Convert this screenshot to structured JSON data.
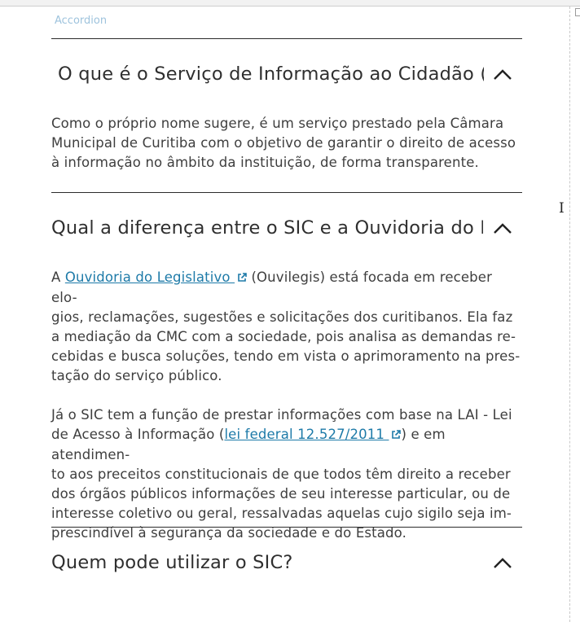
{
  "accordion": {
    "caption": "Accordion",
    "items": [
      {
        "title": "O que é o Serviço de Informação ao Cidadão (SIC)?",
        "expanded": true,
        "body": [
          "Como o próprio nome sugere, é um serviço prestado pela Câmara",
          "Municipal de Curitiba com o objetivo de garantir o direito de acesso",
          "à informação no âmbito da instituição, de forma transparente."
        ]
      },
      {
        "title": "Qual a diferença entre o SIC e a Ouvidoria do Legislativo?",
        "expanded": true,
        "p1": {
          "pre": "A ",
          "link": "Ouvidoria do Legislativo ",
          "post_first": " (Ouvilegis) está focada em receber elo-",
          "lines": [
            "gios, reclamações, sugestões e solicitações dos curitibanos. Ela faz",
            "a mediação da CMC com a sociedade, pois analisa as demandas re-",
            "cebidas e busca soluções, tendo em vista o aprimoramento na pres-",
            "tação do serviço público."
          ]
        },
        "p2": {
          "line1": "Já o SIC tem a função de prestar informações com base na LAI - Lei",
          "pre2": "de Acesso à Informação (",
          "link": "lei federal 12.527/2011 ",
          "post2": ") e em atendimen-",
          "lines": [
            "to aos preceitos constitucionais de que todos têm direito a receber",
            "dos órgãos públicos informações de seu interesse particular, ou de",
            "interesse coletivo ou geral, ressalvadas aquelas cujo sigilo seja im-",
            "prescindível à segurança da sociedade e do Estado."
          ]
        }
      },
      {
        "title": "Quem pode utilizar o SIC?",
        "expanded": true
      }
    ]
  }
}
